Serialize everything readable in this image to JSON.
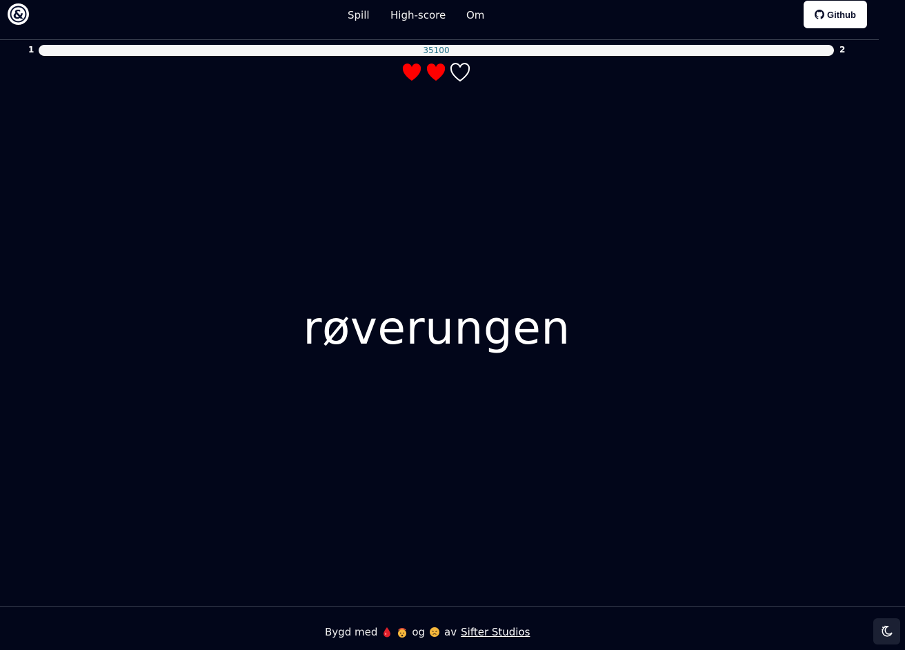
{
  "header": {
    "logo_icon": "ampersand-logo-icon",
    "nav": [
      {
        "label": "Spill"
      },
      {
        "label": "High-score"
      },
      {
        "label": "Om"
      }
    ],
    "github_label": "Github",
    "github_icon": "github-icon"
  },
  "game": {
    "level_current": "1",
    "level_next": "2",
    "score": "35100",
    "progress_fraction": 1.0,
    "lives_total": 3,
    "lives_remaining": 2,
    "word": "røverungen"
  },
  "footer": {
    "built_with": "Bygd med",
    "and": "og",
    "by": "av",
    "studio": "Sifter Studios",
    "emoji_icons": [
      "blood-drop-icon",
      "exploding-head-icon",
      "tired-face-icon"
    ],
    "theme_icon": "moon-stars-icon"
  },
  "colors": {
    "background": "#02061a",
    "heart": "#ff0000",
    "progress_fill": "#f6f6f6",
    "progress_text": "#1e6e86"
  }
}
